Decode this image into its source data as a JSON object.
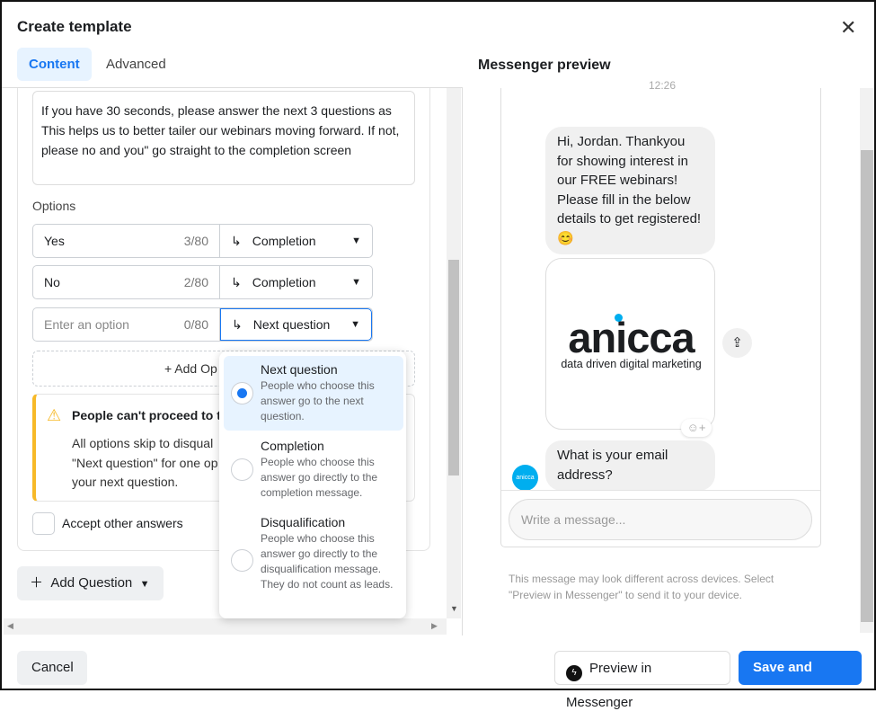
{
  "dialog": {
    "title": "Create template",
    "close_icon": "close-icon"
  },
  "tabs": [
    {
      "label": "Content",
      "active": true
    },
    {
      "label": "Advanced",
      "active": false
    }
  ],
  "question": {
    "text": "If you have 30 seconds, please answer the next 3 questions as This helps us to better tailer our webinars moving forward. If not, please no and you\" go straight to the completion screen"
  },
  "options_label": "Options",
  "options": [
    {
      "value": "Yes",
      "placeholder": "",
      "count": "3/80",
      "action": "Completion"
    },
    {
      "value": "No",
      "placeholder": "",
      "count": "2/80",
      "action": "Completion"
    },
    {
      "value": "",
      "placeholder": "Enter an option",
      "count": "0/80",
      "action": "Next question"
    }
  ],
  "add_option_label": "+ Add Op",
  "warning": {
    "title": "People can't proceed to th",
    "body_lines": [
      "All options skip to disqual",
      "\"Next question\" for one op",
      "your next question."
    ],
    "color": "#f7b928"
  },
  "accept_other_label": "Accept other answers",
  "add_question_label": "Add Question",
  "dropdown": {
    "selected": "Next question",
    "items": [
      {
        "title": "Next question",
        "desc": "People who choose this answer go to the next question."
      },
      {
        "title": "Completion",
        "desc": "People who choose this answer go directly to the completion message."
      },
      {
        "title": "Disqualification",
        "desc": "People who choose this answer go directly to the disqualification message. They do not count as leads."
      }
    ]
  },
  "preview": {
    "title": "Messenger preview",
    "timestamp": "12:26",
    "greeting": "Hi, Jordan. Thankyou for showing interest in our FREE webinars! Please fill in the below details to get registered! 😊",
    "logo": {
      "word": "anicca",
      "tagline": "data driven digital marketing"
    },
    "avatar_text": "anicca",
    "question": "What is your email address?",
    "input_placeholder": "Write a message...",
    "note": "This message may look different across devices. Select \"Preview in Messenger\" to send it to your device."
  },
  "footer": {
    "cancel": "Cancel",
    "preview": "Preview in Messenger",
    "save": "Save and Finish"
  },
  "colors": {
    "accent": "#1877f2",
    "brand": "#00aeef"
  }
}
